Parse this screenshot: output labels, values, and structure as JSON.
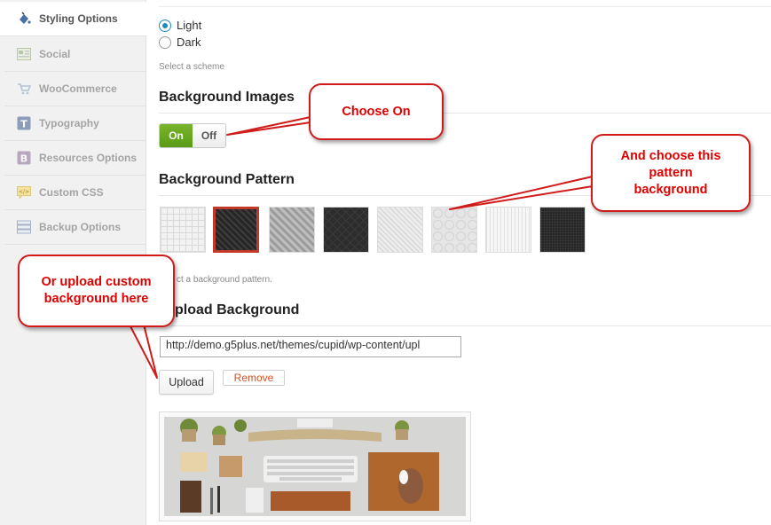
{
  "sidebar": {
    "items": [
      {
        "label": "Styling Options",
        "icon": "paint-bucket-icon",
        "active": true
      },
      {
        "label": "Social",
        "icon": "social-icon"
      },
      {
        "label": "WooCommerce",
        "icon": "cart-icon"
      },
      {
        "label": "Typography",
        "icon": "typography-icon"
      },
      {
        "label": "Resources Options",
        "icon": "resources-icon"
      },
      {
        "label": "Custom CSS",
        "icon": "css-icon"
      },
      {
        "label": "Backup Options",
        "icon": "backup-icon"
      }
    ]
  },
  "scheme": {
    "options": [
      {
        "label": "Light",
        "checked": true
      },
      {
        "label": "Dark",
        "checked": false
      }
    ],
    "help": "Select a scheme"
  },
  "background_images": {
    "title": "Background Images",
    "on_label": "On",
    "off_label": "Off"
  },
  "background_pattern": {
    "title": "Background Pattern",
    "help": "ct a background pattern.",
    "patterns": [
      "light-grid",
      "dark-diagonal",
      "gray-chevron",
      "dark-diamond",
      "light-stripes",
      "light-swirl",
      "light-vertical",
      "dark-dots"
    ],
    "selected_index": 1
  },
  "upload_background": {
    "title": "pload Background",
    "url_value": "http://demo.g5plus.net/themes/cupid/wp-content/upl",
    "upload_label": "Upload",
    "remove_label": "Remove"
  },
  "callouts": {
    "choose_on": "Choose On",
    "choose_pattern": "And choose this pattern background",
    "upload_custom": "Or upload custom background here"
  },
  "colors": {
    "accent_red": "#d11b1b",
    "toggle_green": "#5a9a17",
    "radio_blue": "#1e8cbe"
  }
}
